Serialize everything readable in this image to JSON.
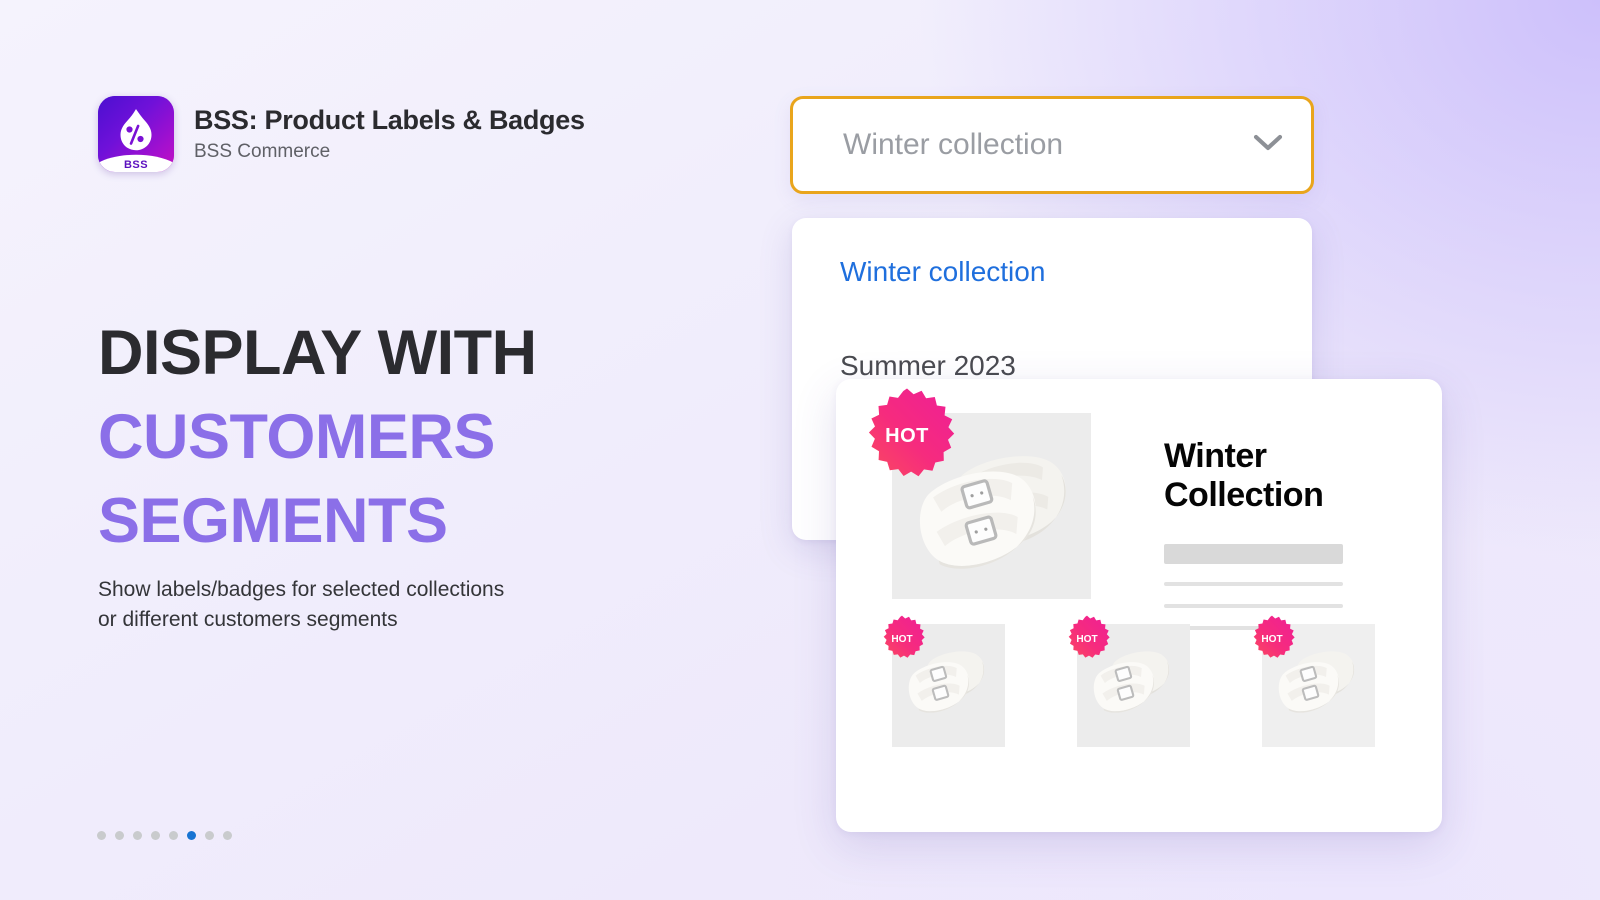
{
  "app": {
    "logo_icon": "flame-percent-logo-icon",
    "logo_wordmark": "BSS",
    "title": "BSS: Product Labels & Badges",
    "vendor": "BSS Commerce"
  },
  "hero": {
    "headline_lines": [
      {
        "text": "DISPLAY WITH",
        "color": "#2b2b2f"
      },
      {
        "text": "CUSTOMERS",
        "color": "#8b6fe8"
      },
      {
        "text": "SEGMENTS",
        "color": "#8b6fe8"
      }
    ],
    "subhead_lines": [
      "Show labels/badges for selected collections",
      "or different customers segments"
    ]
  },
  "pagination": {
    "total": 8,
    "active_index": 5,
    "active_color": "#1874d2",
    "inactive_color": "#c9cbcd"
  },
  "select": {
    "value": "Winter collection",
    "chevron_icon": "chevron-down-icon",
    "border_color": "#e9a51c"
  },
  "dropdown": {
    "options": [
      {
        "label": "Winter collection",
        "selected": true,
        "color": "#1f6fdd"
      },
      {
        "label": "Summer 2023",
        "selected": false,
        "color": "#4a4b50"
      }
    ]
  },
  "product_card": {
    "hero": {
      "image_alt": "white slide sandals with buckles",
      "badge": {
        "text": "HOT",
        "shape": "starburst",
        "gradient_from": "#f9307a",
        "gradient_to": "#ea1f8f"
      },
      "title_lines": [
        "Winter",
        "Collection"
      ],
      "skeleton_rows": 4
    },
    "thumbnails": [
      {
        "image_alt": "white slide sandals with buckles",
        "badge_text": "HOT"
      },
      {
        "image_alt": "white slide sandals with buckles",
        "badge_text": "HOT"
      },
      {
        "image_alt": "white slide sandals with buckles",
        "badge_text": "HOT"
      }
    ]
  },
  "colors": {
    "background_top_right": "#cdc0fb",
    "background_bottom_left": "#f2effe",
    "accent_purple": "#8b6fe8",
    "badge_pink": "#f22c84",
    "amber": "#e9a51c",
    "link_blue": "#1f6fdd"
  }
}
